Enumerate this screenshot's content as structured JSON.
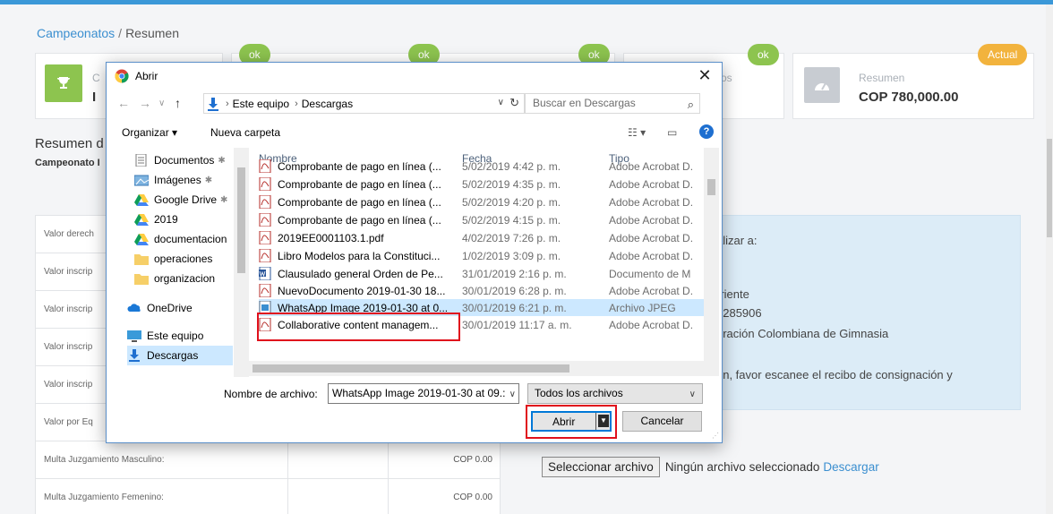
{
  "breadcrumb": {
    "root": "Campeonatos",
    "separator": "/",
    "current": "Resumen"
  },
  "summary_cards": {
    "badges": [
      "ok",
      "ok",
      "ok",
      "ok",
      "Actual"
    ],
    "card1_title_fragment": "C",
    "card1_value_fragment": "I",
    "card4_title_fragment": "os",
    "last_card": {
      "title": "Resumen",
      "value": "COP 780,000.00"
    }
  },
  "section": {
    "title_fragment": "Resumen d",
    "subtitle_fragment": "Campeonato I"
  },
  "fees": [
    {
      "label": "Valor derech",
      "value": ""
    },
    {
      "label": "Valor inscrip",
      "value": ""
    },
    {
      "label": "Valor inscrip",
      "value": ""
    },
    {
      "label": "Valor inscrip",
      "value": ""
    },
    {
      "label": "Valor inscrip",
      "value": ""
    },
    {
      "label": "Valor por Eq",
      "value": ""
    },
    {
      "label": "Multa Juzgamiento Masculino:",
      "value": "COP 0.00"
    },
    {
      "label": "Multa Juzgamiento Femenino:",
      "value": "COP 0.00"
    }
  ],
  "info": {
    "line1": "alizar a:",
    "line2": "rriente",
    "line3": "0285906",
    "line4": "eración Colombiana de Gimnasia",
    "line5": "ón, favor escanee el recibo de consignación y"
  },
  "file_upload": {
    "button": "Seleccionar archivo",
    "status": "Ningún archivo seleccionado",
    "link": "Descargar"
  },
  "dialog": {
    "title": "Abrir",
    "close": "✕",
    "path": {
      "root": "Este equipo",
      "folder": "Descargas"
    },
    "search_placeholder": "Buscar en Descargas",
    "toolbar": {
      "organize": "Organizar ▾",
      "new_folder": "Nueva carpeta"
    },
    "nav_items": [
      {
        "label": "Documentos",
        "icon": "documents-icon",
        "pinned": true
      },
      {
        "label": "Imágenes",
        "icon": "pictures-icon",
        "pinned": true
      },
      {
        "label": "Google Drive",
        "icon": "google-drive-icon",
        "pinned": true
      },
      {
        "label": "2019",
        "icon": "drive-folder-icon",
        "pinned": false
      },
      {
        "label": "documentacion",
        "icon": "drive-folder-icon",
        "pinned": false
      },
      {
        "label": "operaciones",
        "icon": "folder-icon",
        "pinned": false
      },
      {
        "label": "organizacion",
        "icon": "folder-icon",
        "pinned": false
      },
      {
        "label": "OneDrive",
        "icon": "onedrive-icon",
        "pinned": false
      },
      {
        "label": "Este equipo",
        "icon": "computer-icon",
        "pinned": false
      },
      {
        "label": "Descargas",
        "icon": "downloads-icon",
        "pinned": false
      }
    ],
    "columns": {
      "name": "Nombre",
      "date": "Fecha",
      "type": "Tipo"
    },
    "files": [
      {
        "name": "Comprobante de pago en línea (...",
        "date": "5/02/2019 4:42 p. m.",
        "type": "Adobe Acrobat D.",
        "icon": "pdf-icon"
      },
      {
        "name": "Comprobante de pago en línea (...",
        "date": "5/02/2019 4:35 p. m.",
        "type": "Adobe Acrobat D.",
        "icon": "pdf-icon"
      },
      {
        "name": "Comprobante de pago en línea (...",
        "date": "5/02/2019 4:20 p. m.",
        "type": "Adobe Acrobat D.",
        "icon": "pdf-icon"
      },
      {
        "name": "Comprobante de pago en línea (...",
        "date": "5/02/2019 4:15 p. m.",
        "type": "Adobe Acrobat D.",
        "icon": "pdf-icon"
      },
      {
        "name": "2019EE0001103.1.pdf",
        "date": "4/02/2019 7:26 p. m.",
        "type": "Adobe Acrobat D.",
        "icon": "pdf-icon"
      },
      {
        "name": "Libro Modelos para la Constituci...",
        "date": "1/02/2019 3:09 p. m.",
        "type": "Adobe Acrobat D.",
        "icon": "pdf-icon"
      },
      {
        "name": "Clausulado general Orden de Pe...",
        "date": "31/01/2019 2:16 p. m.",
        "type": "Documento de M",
        "icon": "word-icon"
      },
      {
        "name": "NuevoDocumento 2019-01-30 18...",
        "date": "30/01/2019 6:28 p. m.",
        "type": "Adobe Acrobat D.",
        "icon": "pdf-icon"
      },
      {
        "name": "WhatsApp Image 2019-01-30 at 0...",
        "date": "30/01/2019 6:21 p. m.",
        "type": "Archivo JPEG",
        "icon": "image-icon",
        "selected": true
      },
      {
        "name": "Collaborative content managem...",
        "date": "30/01/2019 11:17 a. m.",
        "type": "Adobe Acrobat D.",
        "icon": "pdf-icon"
      }
    ],
    "filename_label": "Nombre de archivo:",
    "filename_value": "WhatsApp Image 2019-01-30 at 09.:",
    "filter": "Todos los archivos",
    "open_button": "Abrir",
    "cancel_button": "Cancelar"
  }
}
